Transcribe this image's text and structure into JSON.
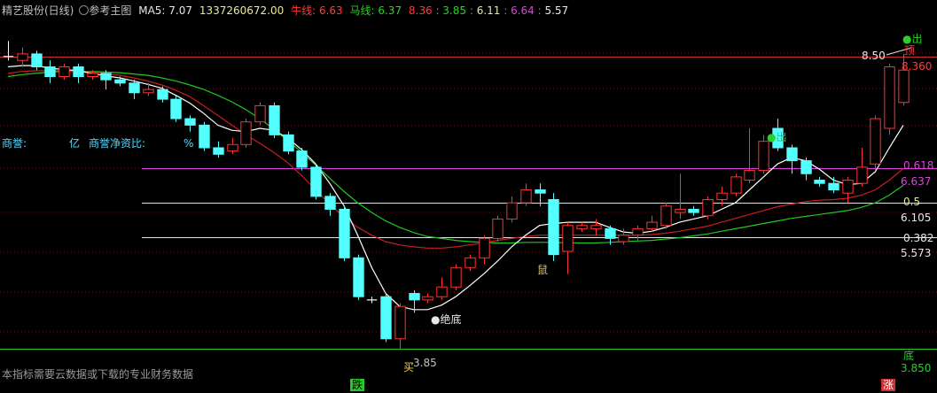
{
  "header": {
    "stock": "精艺股份(日线)",
    "main_label": "参考主图",
    "ma5": "MA5: 7.07",
    "vol": "1337260672.00",
    "bull_label": "牛线: 6.63",
    "horse_label": "马线: 6.37",
    "v1": "8.36",
    "v2": "3.85",
    "v3": "6.11",
    "v4": "6.64",
    "v5": "5.57"
  },
  "goodwill": {
    "label1": "商誉:",
    "unit1": "亿",
    "label2": "商誉净资比:",
    "unit2": "%"
  },
  "footer_note": "本指标需要云数据或下载的专业财务数据",
  "right_labels": {
    "top": "8.360",
    "arrow_price": "8.50",
    "fib618": "0.618",
    "fib618_price": "6.637",
    "fib5": "0.5",
    "fib5_price": "6.105",
    "fib382": "0.382",
    "fib382_price": "5.573",
    "bottom": "3.850"
  },
  "annotations": {
    "sell_top": "顶",
    "out1": "●出",
    "out2": "●出",
    "jue_di": "●绝底",
    "shu": "鼠",
    "mai": "买",
    "low_price": "3.85",
    "die": "跌",
    "zhang": "涨",
    "di": "底"
  },
  "colors": {
    "up": "#ff3232",
    "down": "#54ffff",
    "ma_white": "#ffffff",
    "bull_red": "#c81e1e",
    "horse_green": "#1ec81e",
    "fib618": "#e040e0",
    "fib5": "#e8e8a0",
    "level_red": "#c83232",
    "level_green": "#28c828"
  },
  "chart_data": {
    "type": "candlestick",
    "ylim": [
      3.6,
      8.85
    ],
    "levels": [
      {
        "name": "top",
        "value": 8.36
      },
      {
        "name": "0.618",
        "value": 6.637
      },
      {
        "name": "0.5",
        "value": 6.105
      },
      {
        "name": "0.382",
        "value": 5.573
      },
      {
        "name": "bottom",
        "value": 3.85
      }
    ],
    "candles": [
      [
        8.36,
        8.36,
        8.6,
        8.3
      ],
      [
        8.3,
        8.4,
        8.5,
        8.2
      ],
      [
        8.4,
        8.2,
        8.45,
        8.15
      ],
      [
        8.2,
        8.05,
        8.3,
        7.95
      ],
      [
        8.05,
        8.2,
        8.25,
        8.0
      ],
      [
        8.2,
        8.05,
        8.25,
        7.95
      ],
      [
        8.05,
        8.1,
        8.15,
        8.0
      ],
      [
        8.1,
        8.0,
        8.15,
        7.85
      ],
      [
        8.0,
        7.95,
        8.05,
        7.9
      ],
      [
        7.95,
        7.8,
        8.0,
        7.7
      ],
      [
        7.8,
        7.85,
        7.95,
        7.75
      ],
      [
        7.85,
        7.7,
        7.9,
        7.65
      ],
      [
        7.7,
        7.4,
        7.75,
        7.35
      ],
      [
        7.4,
        7.3,
        7.45,
        7.2
      ],
      [
        7.3,
        6.95,
        7.35,
        6.9
      ],
      [
        6.95,
        6.85,
        7.05,
        6.8
      ],
      [
        6.9,
        7.0,
        7.1,
        6.85
      ],
      [
        7.0,
        7.35,
        7.4,
        6.95
      ],
      [
        7.35,
        7.6,
        7.65,
        7.3
      ],
      [
        7.6,
        7.15,
        7.65,
        7.1
      ],
      [
        7.15,
        6.9,
        7.2,
        6.85
      ],
      [
        6.9,
        6.65,
        6.95,
        6.6
      ],
      [
        6.65,
        6.2,
        6.7,
        6.15
      ],
      [
        6.2,
        6.0,
        6.25,
        5.9
      ],
      [
        6.0,
        5.25,
        6.05,
        5.2
      ],
      [
        5.25,
        4.65,
        5.3,
        4.6
      ],
      [
        4.6,
        4.6,
        4.65,
        4.55
      ],
      [
        4.65,
        4.0,
        4.7,
        3.95
      ],
      [
        4.0,
        4.5,
        4.55,
        3.85
      ],
      [
        4.7,
        4.6,
        4.75,
        4.4
      ],
      [
        4.6,
        4.65,
        4.7,
        4.55
      ],
      [
        4.65,
        4.8,
        4.95,
        4.6
      ],
      [
        4.8,
        5.1,
        5.15,
        4.75
      ],
      [
        5.1,
        5.25,
        5.3,
        5.05
      ],
      [
        5.25,
        5.55,
        5.6,
        5.15
      ],
      [
        5.55,
        5.85,
        5.9,
        5.5
      ],
      [
        5.85,
        6.1,
        6.2,
        5.8
      ],
      [
        6.1,
        6.3,
        6.4,
        6.05
      ],
      [
        6.3,
        6.25,
        6.4,
        6.05
      ],
      [
        6.15,
        5.3,
        6.25,
        5.2
      ],
      [
        5.35,
        5.75,
        5.8,
        5.0
      ],
      [
        5.7,
        5.75,
        5.8,
        5.65
      ],
      [
        5.7,
        5.75,
        5.85,
        5.6
      ],
      [
        5.7,
        5.55,
        5.75,
        5.45
      ],
      [
        5.5,
        5.6,
        5.7,
        5.45
      ],
      [
        5.6,
        5.7,
        5.75,
        5.5
      ],
      [
        5.7,
        5.8,
        5.9,
        5.65
      ],
      [
        5.75,
        6.05,
        6.1,
        5.7
      ],
      [
        5.95,
        6.0,
        6.55,
        5.85
      ],
      [
        6.0,
        5.95,
        6.05,
        5.9
      ],
      [
        5.9,
        6.15,
        6.2,
        5.85
      ],
      [
        6.15,
        6.25,
        6.35,
        6.05
      ],
      [
        6.25,
        6.5,
        6.55,
        6.2
      ],
      [
        6.45,
        6.6,
        7.25,
        6.4
      ],
      [
        6.6,
        7.05,
        7.15,
        6.55
      ],
      [
        7.25,
        6.95,
        7.4,
        6.9
      ],
      [
        6.95,
        6.75,
        7.0,
        6.55
      ],
      [
        6.75,
        6.55,
        6.8,
        6.45
      ],
      [
        6.45,
        6.4,
        6.5,
        6.35
      ],
      [
        6.4,
        6.3,
        6.5,
        6.25
      ],
      [
        6.25,
        6.45,
        6.5,
        6.1
      ],
      [
        6.4,
        6.65,
        6.95,
        6.35
      ],
      [
        6.7,
        7.4,
        7.45,
        6.6
      ],
      [
        7.25,
        8.2,
        8.25,
        7.15
      ],
      [
        7.65,
        8.15,
        8.4,
        7.6
      ]
    ],
    "ma_white": [
      8.2,
      8.22,
      8.22,
      8.18,
      8.16,
      8.14,
      8.1,
      8.06,
      8.03,
      7.98,
      7.93,
      7.87,
      7.76,
      7.64,
      7.48,
      7.3,
      7.22,
      7.2,
      7.25,
      7.22,
      7.1,
      6.92,
      6.7,
      6.4,
      6.06,
      5.6,
      5.1,
      4.7,
      4.5,
      4.45,
      4.45,
      4.52,
      4.65,
      4.82,
      5.0,
      5.2,
      5.42,
      5.6,
      5.75,
      5.78,
      5.8,
      5.8,
      5.8,
      5.72,
      5.65,
      5.63,
      5.66,
      5.72,
      5.8,
      5.85,
      5.9,
      6.0,
      6.1,
      6.3,
      6.5,
      6.7,
      6.8,
      6.75,
      6.62,
      6.45,
      6.38,
      6.4,
      6.58,
      6.95,
      7.3
    ],
    "bull_red": [
      8.1,
      8.13,
      8.14,
      8.14,
      8.14,
      8.13,
      8.12,
      8.1,
      8.07,
      8.03,
      7.98,
      7.92,
      7.84,
      7.74,
      7.6,
      7.45,
      7.3,
      7.15,
      7.02,
      6.88,
      6.72,
      6.52,
      6.3,
      6.08,
      5.88,
      5.72,
      5.6,
      5.5,
      5.45,
      5.42,
      5.4,
      5.4,
      5.42,
      5.45,
      5.48,
      5.52,
      5.55,
      5.58,
      5.6,
      5.6,
      5.6,
      5.6,
      5.6,
      5.6,
      5.6,
      5.6,
      5.61,
      5.63,
      5.66,
      5.7,
      5.74,
      5.8,
      5.86,
      5.92,
      5.98,
      6.04,
      6.08,
      6.12,
      6.14,
      6.15,
      6.17,
      6.22,
      6.3,
      6.45,
      6.63
    ],
    "horse_green": [
      8.05,
      8.08,
      8.1,
      8.12,
      8.13,
      8.13,
      8.13,
      8.12,
      8.11,
      8.09,
      8.07,
      8.03,
      7.98,
      7.92,
      7.85,
      7.76,
      7.66,
      7.54,
      7.4,
      7.24,
      7.06,
      6.88,
      6.68,
      6.48,
      6.28,
      6.1,
      5.95,
      5.82,
      5.72,
      5.64,
      5.58,
      5.55,
      5.52,
      5.5,
      5.49,
      5.48,
      5.48,
      5.49,
      5.49,
      5.49,
      5.48,
      5.48,
      5.48,
      5.49,
      5.5,
      5.51,
      5.52,
      5.54,
      5.56,
      5.59,
      5.62,
      5.66,
      5.7,
      5.74,
      5.78,
      5.82,
      5.86,
      5.89,
      5.92,
      5.95,
      5.98,
      6.03,
      6.1,
      6.22,
      6.37
    ]
  }
}
